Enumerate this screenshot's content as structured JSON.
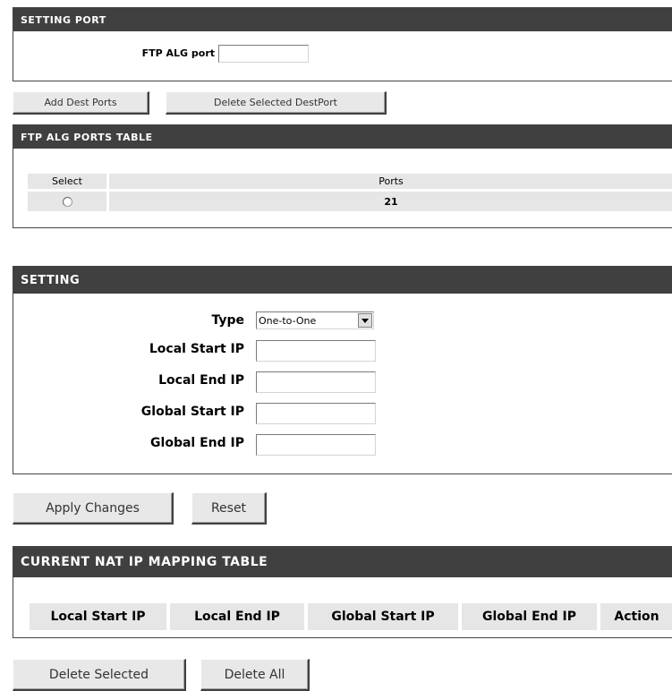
{
  "setting_port": {
    "title": "SETTING PORT",
    "ftp_alg_port_label": "FTP ALG port",
    "ftp_alg_port_value": ""
  },
  "port_buttons": {
    "add": "Add Dest Ports",
    "delete_selected": "Delete Selected DestPort"
  },
  "ftp_alg_table": {
    "title": "FTP ALG PORTS TABLE",
    "columns": [
      "Select",
      "Ports"
    ],
    "rows": [
      {
        "selected": false,
        "port": "21"
      }
    ]
  },
  "setting": {
    "title": "SETTING",
    "type_label": "Type",
    "type_value": "One-to-One",
    "local_start_ip_label": "Local Start IP",
    "local_end_ip_label": "Local End IP",
    "global_start_ip_label": "Global Start IP",
    "global_end_ip_label": "Global End IP"
  },
  "setting_buttons": {
    "apply": "Apply Changes",
    "reset": "Reset"
  },
  "mapping_table": {
    "title": "CURRENT NAT IP MAPPING TABLE",
    "columns": [
      "Local Start IP",
      "Local End IP",
      "Global Start IP",
      "Global End IP",
      "Action"
    ]
  },
  "mapping_buttons": {
    "delete_selected": "Delete Selected",
    "delete_all": "Delete All"
  }
}
